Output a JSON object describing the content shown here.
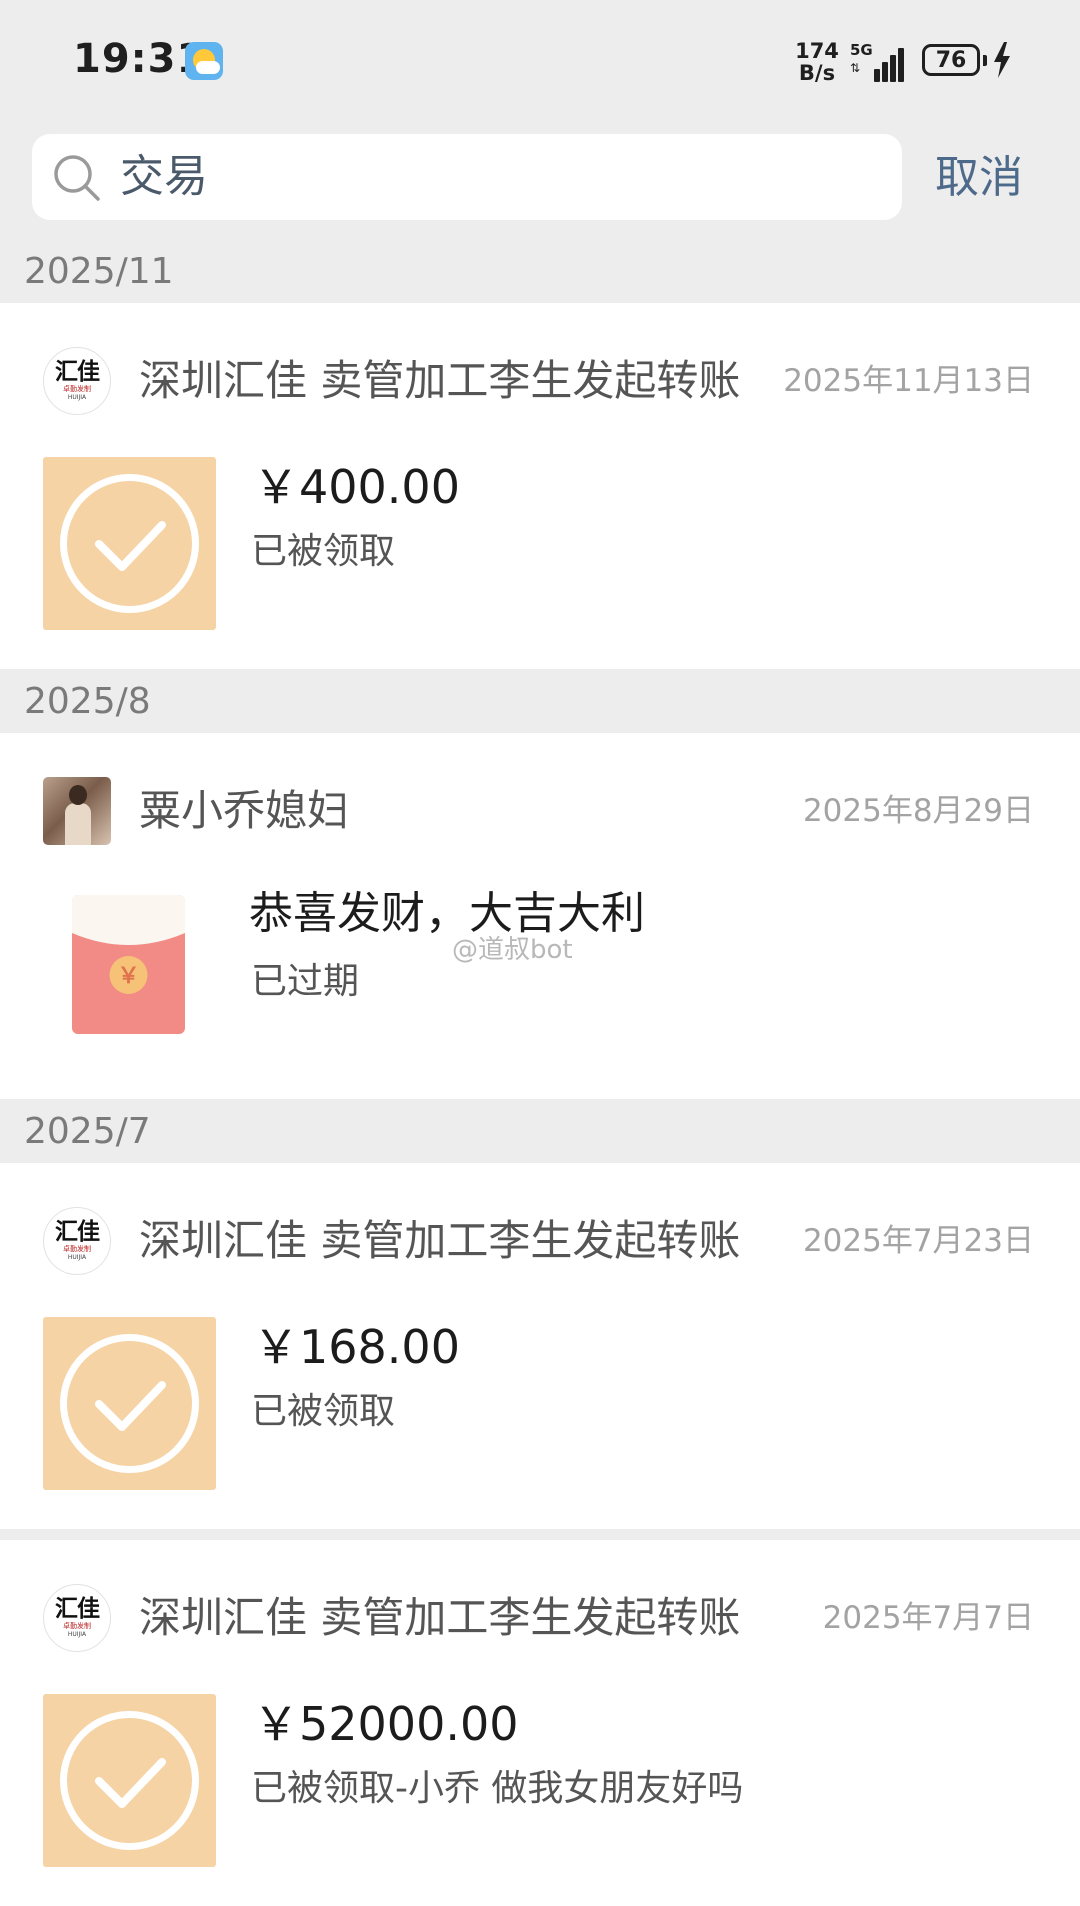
{
  "status_bar": {
    "time": "19:31",
    "net_speed_value": "174",
    "net_speed_unit": "B/s",
    "network": "5G",
    "battery": "76",
    "icons": [
      "weather-icon",
      "signal-icon",
      "battery-icon",
      "charging-bolt-icon"
    ]
  },
  "search": {
    "query": "交易",
    "cancel_label": "取消"
  },
  "sections": [
    {
      "date": "2025/11",
      "items": [
        {
          "sender": "深圳汇佳 卖管加工李生发起转账",
          "date": "2025年11月13日",
          "amount": "￥400.00",
          "status": "已被领取",
          "type": "transfer"
        }
      ]
    },
    {
      "date": "2025/8",
      "items": [
        {
          "sender": "粟小乔媳妇",
          "date": "2025年8月29日",
          "title": "恭喜发财，大吉大利",
          "status": "已过期",
          "type": "red-packet"
        }
      ]
    },
    {
      "date": "2025/7",
      "items": [
        {
          "sender": "深圳汇佳 卖管加工李生发起转账",
          "date": "2025年7月23日",
          "amount": "￥168.00",
          "status": "已被领取",
          "type": "transfer"
        },
        {
          "sender": "深圳汇佳 卖管加工李生发起转账",
          "date": "2025年7月7日",
          "amount": "￥52000.00",
          "status": "已被领取-小乔 做我女朋友好吗",
          "type": "transfer"
        }
      ]
    }
  ],
  "avatar_logo": {
    "main": "汇佳",
    "sub": "卓勤发制",
    "sub2": "HUIJIA"
  },
  "red_packet_symbol": "￥",
  "watermark": "@道叔bot",
  "colors": {
    "background": "#ededed",
    "card": "#ffffff",
    "transfer_thumb": "#f6d3a4",
    "red_packet": "#f28b85",
    "cancel_link": "#4e6a8b"
  }
}
